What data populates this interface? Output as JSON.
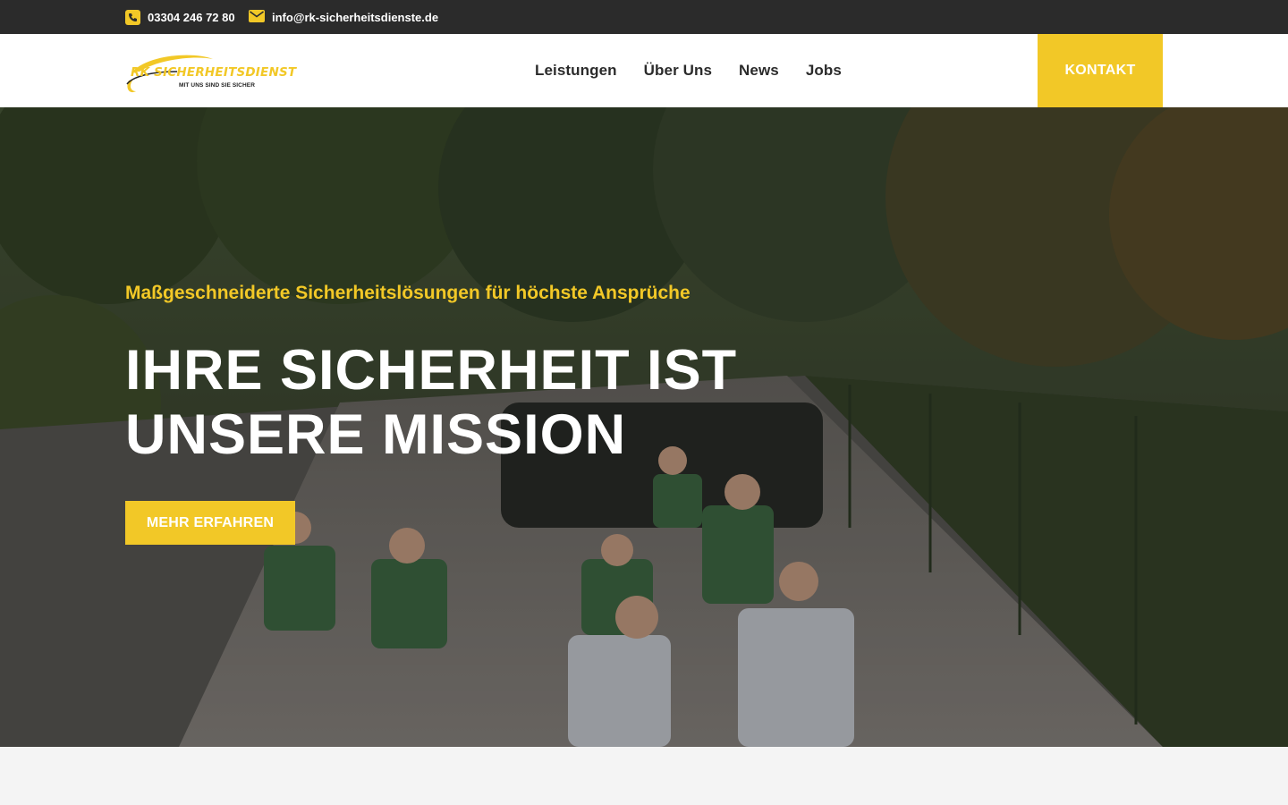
{
  "topbar": {
    "phone": "03304 246 72 80",
    "email": "info@rk-sicherheitsdienste.de"
  },
  "brand": {
    "name": "RK SICHERHEITSDIENST",
    "tagline": "MIT UNS SIND SIE SICHER",
    "accent_color": "#f2c827"
  },
  "nav": {
    "items": [
      {
        "label": "Leistungen"
      },
      {
        "label": "Über Uns"
      },
      {
        "label": "News"
      },
      {
        "label": "Jobs"
      }
    ],
    "cta_label": "KONTAKT"
  },
  "hero": {
    "kicker": "Maßgeschneiderte Sicherheitslösungen für höchste Ansprüche",
    "title": "IHRE SICHERHEIT IST UNSERE MISSION",
    "cta_label": "MEHR ERFAHREN"
  },
  "icons": {
    "phone": "phone-icon",
    "email": "envelope-icon"
  }
}
